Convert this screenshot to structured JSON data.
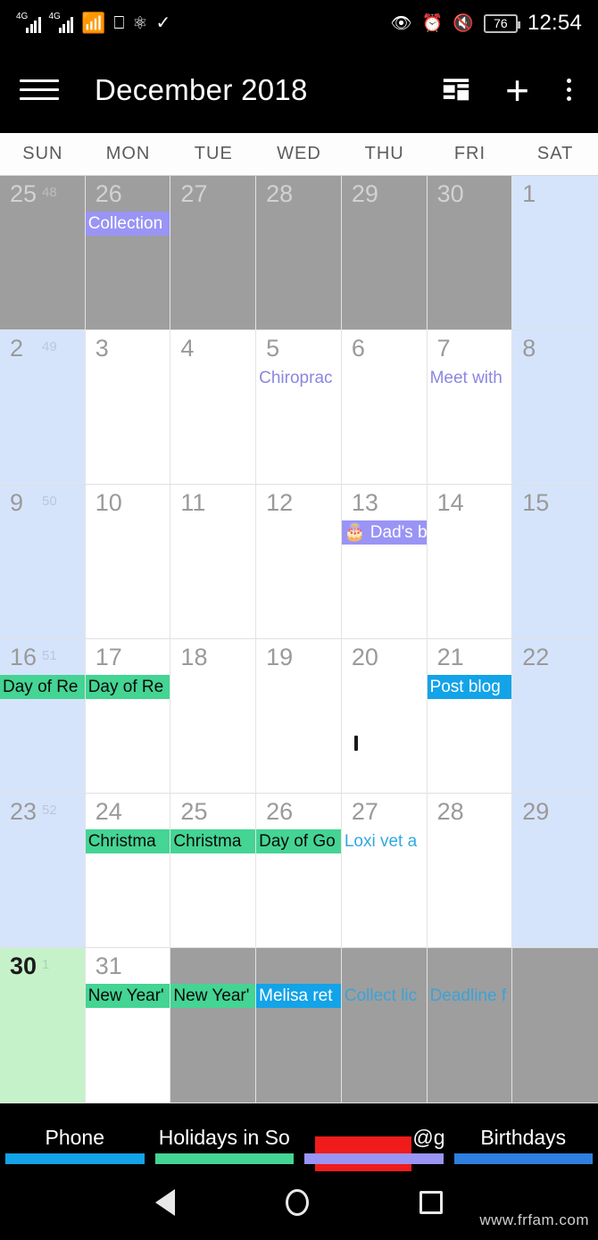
{
  "status_bar": {
    "network_label": "4G",
    "network_label_2": "4G",
    "icons": [
      "4g-signal-icon",
      "4g-signal-icon",
      "wifi-icon",
      "cast-icon",
      "bluetooth-icon",
      "check-circle-icon"
    ],
    "right_icons": [
      "eye-care-icon",
      "alarm-icon",
      "mute-icon"
    ],
    "battery_percent": "76",
    "time": "12:54"
  },
  "app_bar": {
    "title": "December 2018",
    "menu_icon": "hamburger-menu-icon",
    "view_toggle_icon": "agenda-view-icon",
    "add_icon": "plus-icon",
    "overflow_icon": "more-vertical-icon"
  },
  "weekdays": [
    "SUN",
    "MON",
    "TUE",
    "WED",
    "THU",
    "FRI",
    "SAT"
  ],
  "weeks": [
    {
      "week_number": "48",
      "days": [
        {
          "num": "25",
          "out": true,
          "weekend": true,
          "today": false,
          "events": []
        },
        {
          "num": "26",
          "out": true,
          "weekend": false,
          "today": false,
          "events": [
            {
              "text": "Collection",
              "style": "chip-purple"
            }
          ]
        },
        {
          "num": "27",
          "out": true,
          "weekend": false,
          "today": false,
          "events": []
        },
        {
          "num": "28",
          "out": true,
          "weekend": false,
          "today": false,
          "events": []
        },
        {
          "num": "29",
          "out": true,
          "weekend": false,
          "today": false,
          "events": []
        },
        {
          "num": "30",
          "out": true,
          "weekend": false,
          "today": false,
          "events": []
        },
        {
          "num": "1",
          "out": false,
          "weekend": true,
          "today": false,
          "events": []
        }
      ]
    },
    {
      "week_number": "49",
      "days": [
        {
          "num": "2",
          "out": false,
          "weekend": true,
          "today": false,
          "events": []
        },
        {
          "num": "3",
          "out": false,
          "weekend": false,
          "today": false,
          "events": []
        },
        {
          "num": "4",
          "out": false,
          "weekend": false,
          "today": false,
          "events": []
        },
        {
          "num": "5",
          "out": false,
          "weekend": false,
          "today": false,
          "events": [
            {
              "text": "Chiroprac",
              "style": "txt-purple"
            }
          ]
        },
        {
          "num": "6",
          "out": false,
          "weekend": false,
          "today": false,
          "events": []
        },
        {
          "num": "7",
          "out": false,
          "weekend": false,
          "today": false,
          "events": [
            {
              "text": "Meet with",
              "style": "txt-purple"
            }
          ]
        },
        {
          "num": "8",
          "out": false,
          "weekend": true,
          "today": false,
          "events": []
        }
      ]
    },
    {
      "week_number": "50",
      "days": [
        {
          "num": "9",
          "out": false,
          "weekend": true,
          "today": false,
          "events": []
        },
        {
          "num": "10",
          "out": false,
          "weekend": false,
          "today": false,
          "events": []
        },
        {
          "num": "11",
          "out": false,
          "weekend": false,
          "today": false,
          "events": []
        },
        {
          "num": "12",
          "out": false,
          "weekend": false,
          "today": false,
          "events": []
        },
        {
          "num": "13",
          "out": false,
          "weekend": false,
          "today": false,
          "events": [
            {
              "text": "🎂 Dad's b",
              "style": "chip-purple"
            }
          ]
        },
        {
          "num": "14",
          "out": false,
          "weekend": false,
          "today": false,
          "events": []
        },
        {
          "num": "15",
          "out": false,
          "weekend": true,
          "today": false,
          "events": []
        }
      ]
    },
    {
      "week_number": "51",
      "days": [
        {
          "num": "16",
          "out": false,
          "weekend": true,
          "today": false,
          "events": [
            {
              "text": "Day of Re",
              "style": "chip-green"
            }
          ]
        },
        {
          "num": "17",
          "out": false,
          "weekend": false,
          "today": false,
          "events": [
            {
              "text": "Day of Re",
              "style": "chip-green"
            }
          ]
        },
        {
          "num": "18",
          "out": false,
          "weekend": false,
          "today": false,
          "events": []
        },
        {
          "num": "19",
          "out": false,
          "weekend": false,
          "today": false,
          "events": []
        },
        {
          "num": "20",
          "out": false,
          "weekend": false,
          "today": false,
          "events": [],
          "stray_mark": true
        },
        {
          "num": "21",
          "out": false,
          "weekend": false,
          "today": false,
          "events": [
            {
              "text": "Post blog",
              "style": "chip-blue"
            }
          ]
        },
        {
          "num": "22",
          "out": false,
          "weekend": true,
          "today": false,
          "events": []
        }
      ]
    },
    {
      "week_number": "52",
      "days": [
        {
          "num": "23",
          "out": false,
          "weekend": true,
          "today": false,
          "events": []
        },
        {
          "num": "24",
          "out": false,
          "weekend": false,
          "today": false,
          "events": [
            {
              "text": "Christma",
              "style": "chip-green"
            }
          ]
        },
        {
          "num": "25",
          "out": false,
          "weekend": false,
          "today": false,
          "events": [
            {
              "text": "Christma",
              "style": "chip-green"
            }
          ]
        },
        {
          "num": "26",
          "out": false,
          "weekend": false,
          "today": false,
          "events": [
            {
              "text": "Day of Go",
              "style": "chip-green"
            }
          ]
        },
        {
          "num": "27",
          "out": false,
          "weekend": false,
          "today": false,
          "events": [
            {
              "text": "Loxi vet a",
              "style": "txt-blue"
            }
          ]
        },
        {
          "num": "28",
          "out": false,
          "weekend": false,
          "today": false,
          "events": []
        },
        {
          "num": "29",
          "out": false,
          "weekend": true,
          "today": false,
          "events": []
        }
      ]
    },
    {
      "week_number": "1",
      "days": [
        {
          "num": "30",
          "out": false,
          "weekend": true,
          "today": true,
          "events": []
        },
        {
          "num": "31",
          "out": false,
          "weekend": false,
          "today": false,
          "events": [
            {
              "text": "New Year'",
              "style": "chip-green"
            }
          ]
        },
        {
          "num": "",
          "out": true,
          "weekend": false,
          "today": false,
          "events": [
            {
              "text": "New Year'",
              "style": "chip-green"
            }
          ]
        },
        {
          "num": "",
          "out": true,
          "weekend": false,
          "today": false,
          "events": [
            {
              "text": "Melisa ret",
              "style": "chip-blue"
            }
          ]
        },
        {
          "num": "",
          "out": true,
          "weekend": false,
          "today": false,
          "events": [
            {
              "text": "Collect lic",
              "style": "txt-blue-dim"
            }
          ]
        },
        {
          "num": "",
          "out": true,
          "weekend": false,
          "today": false,
          "events": [
            {
              "text": "Deadline f",
              "style": "txt-blue-dim"
            }
          ]
        },
        {
          "num": "",
          "out": true,
          "weekend": true,
          "today": false,
          "events": []
        }
      ]
    }
  ],
  "calendar_filters": [
    {
      "label": "Phone",
      "color": "#12a3e8",
      "redacted": false
    },
    {
      "label": "Holidays in So",
      "color": "#44d493",
      "redacted": false
    },
    {
      "label": "@g",
      "color": "#9a94f5",
      "redacted": true
    },
    {
      "label": "Birthdays",
      "color": "#2e7fe0",
      "redacted": false
    }
  ],
  "nav_bar": {
    "back_icon": "back-triangle-icon",
    "home_icon": "home-circle-icon",
    "recents_icon": "recents-square-icon",
    "watermark": "www.frfam.com"
  }
}
